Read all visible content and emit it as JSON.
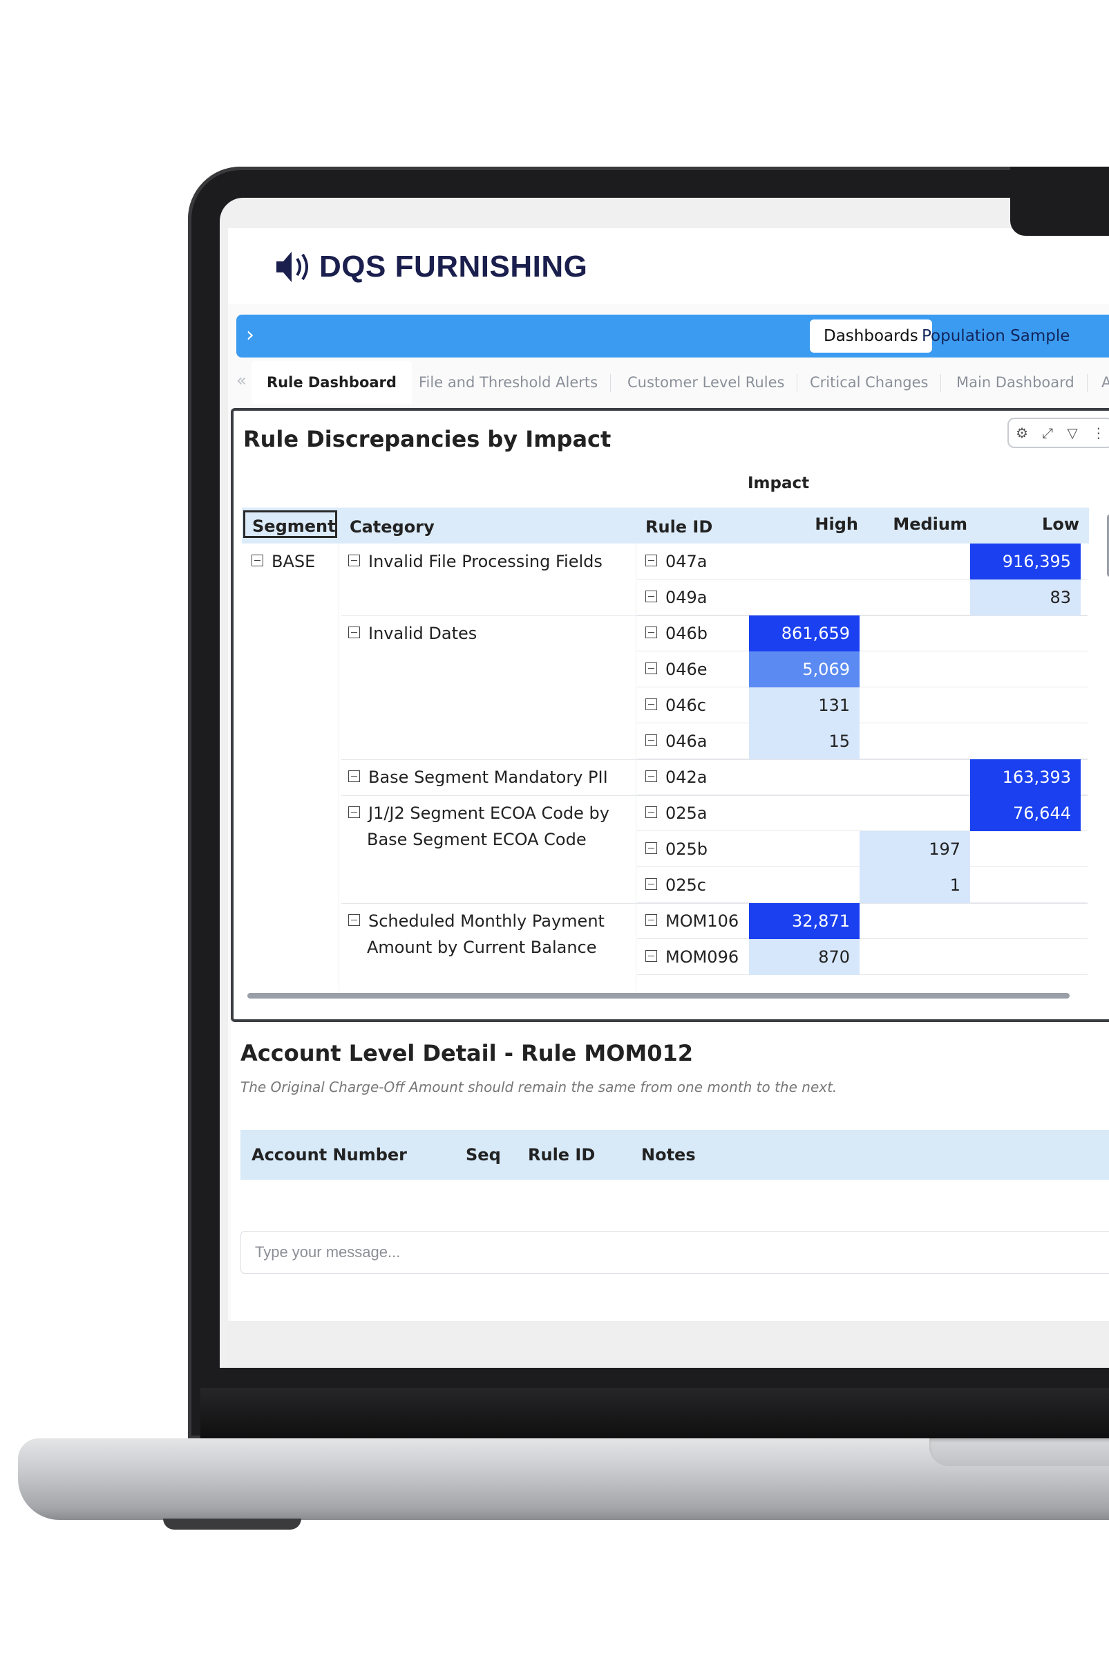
{
  "brand": {
    "name": "DQS FURNISHING",
    "logo_icon": "speaker-waves-logo",
    "color": "#1b1f4d"
  },
  "topbar": {
    "expand_icon": "chevron-right-icon",
    "tabs": [
      "Dashboards",
      "Population Sample"
    ],
    "active": "Dashboards",
    "color": "#3b9bf0"
  },
  "page_tabs": [
    "Rule Dashboard",
    "File and Threshold Alerts",
    "Customer Level Rules",
    "Critical Changes",
    "Main Dashboard",
    "A"
  ],
  "active_page_tab": "Rule Dashboard",
  "matrix": {
    "title": "Rule Discrepancies by Impact",
    "column_group": "Impact",
    "headers": {
      "segment": "Segment",
      "category": "Category",
      "rule_id": "Rule ID",
      "high": "High",
      "medium": "Medium",
      "low": "Low"
    },
    "segment": "BASE",
    "categories": [
      {
        "name": "Invalid File Processing Fields",
        "line2": ""
      },
      {
        "name": "Invalid Dates",
        "line2": ""
      },
      {
        "name": "Base Segment Mandatory PII",
        "line2": ""
      },
      {
        "name": "J1/J2 Segment ECOA Code by",
        "line2": "Base Segment ECOA Code"
      },
      {
        "name": "Scheduled Monthly Payment",
        "line2": "Amount by Current Balance"
      }
    ],
    "rows": [
      {
        "rule_id": "047a",
        "high": "",
        "medium": "",
        "low": "916,395"
      },
      {
        "rule_id": "049a",
        "high": "",
        "medium": "",
        "low": "83"
      },
      {
        "rule_id": "046b",
        "high": "861,659",
        "medium": "",
        "low": ""
      },
      {
        "rule_id": "046e",
        "high": "5,069",
        "medium": "",
        "low": ""
      },
      {
        "rule_id": "046c",
        "high": "131",
        "medium": "",
        "low": ""
      },
      {
        "rule_id": "046a",
        "high": "15",
        "medium": "",
        "low": ""
      },
      {
        "rule_id": "042a",
        "high": "",
        "medium": "",
        "low": "163,393"
      },
      {
        "rule_id": "025a",
        "high": "",
        "medium": "",
        "low": "76,644"
      },
      {
        "rule_id": "025b",
        "high": "",
        "medium": "197",
        "low": ""
      },
      {
        "rule_id": "025c",
        "high": "",
        "medium": "1",
        "low": ""
      },
      {
        "rule_id": "MOM106",
        "high": "32,871",
        "medium": "",
        "low": ""
      },
      {
        "rule_id": "MOM096",
        "high": "870",
        "medium": "",
        "low": ""
      }
    ],
    "heat_colors": {
      "dark": "#1a40f0",
      "mid": "#5a8af2",
      "light": "#d6e6fb"
    },
    "toolbar_icons": [
      "pin-icon",
      "expand-icon",
      "filter-icon",
      "more-icon"
    ]
  },
  "detail": {
    "title": "Account Level Detail - Rule MOM012",
    "subtitle": "The Original Charge-Off Amount should remain the same from one month to the next.",
    "columns": [
      "Account Number",
      "Seq",
      "Rule ID",
      "Notes"
    ]
  },
  "chat": {
    "placeholder": "Type your message..."
  }
}
